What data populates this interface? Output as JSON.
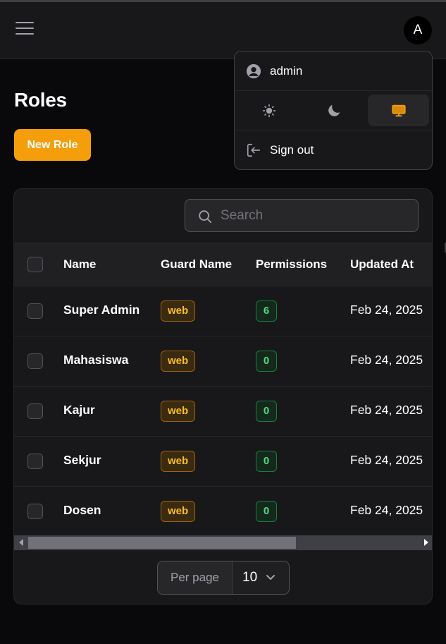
{
  "header": {
    "avatar_initial": "A"
  },
  "page": {
    "title": "Roles",
    "new_button": "New Role"
  },
  "search": {
    "placeholder": "Search",
    "value": ""
  },
  "table": {
    "columns": [
      "Name",
      "Guard Name",
      "Permissions",
      "Updated At"
    ],
    "rows": [
      {
        "name": "Super Admin",
        "guard": "web",
        "permissions": "6",
        "updated": "Feb 24, 2025"
      },
      {
        "name": "Mahasiswa",
        "guard": "web",
        "permissions": "0",
        "updated": "Feb 24, 2025"
      },
      {
        "name": "Kajur",
        "guard": "web",
        "permissions": "0",
        "updated": "Feb 24, 2025"
      },
      {
        "name": "Sekjur",
        "guard": "web",
        "permissions": "0",
        "updated": "Feb 24, 2025"
      },
      {
        "name": "Dosen",
        "guard": "web",
        "permissions": "0",
        "updated": "Feb 24, 2025"
      }
    ]
  },
  "pagination": {
    "per_page_label": "Per page",
    "per_page_value": "10"
  },
  "user_menu": {
    "username": "admin",
    "themes": [
      "sun-icon",
      "moon-icon",
      "monitor-icon"
    ],
    "active_theme": "monitor-icon",
    "sign_out": "Sign out"
  },
  "colors": {
    "accent": "#f59e0b",
    "success": "#4ade80",
    "background": "#09090b",
    "surface": "#18181b"
  }
}
